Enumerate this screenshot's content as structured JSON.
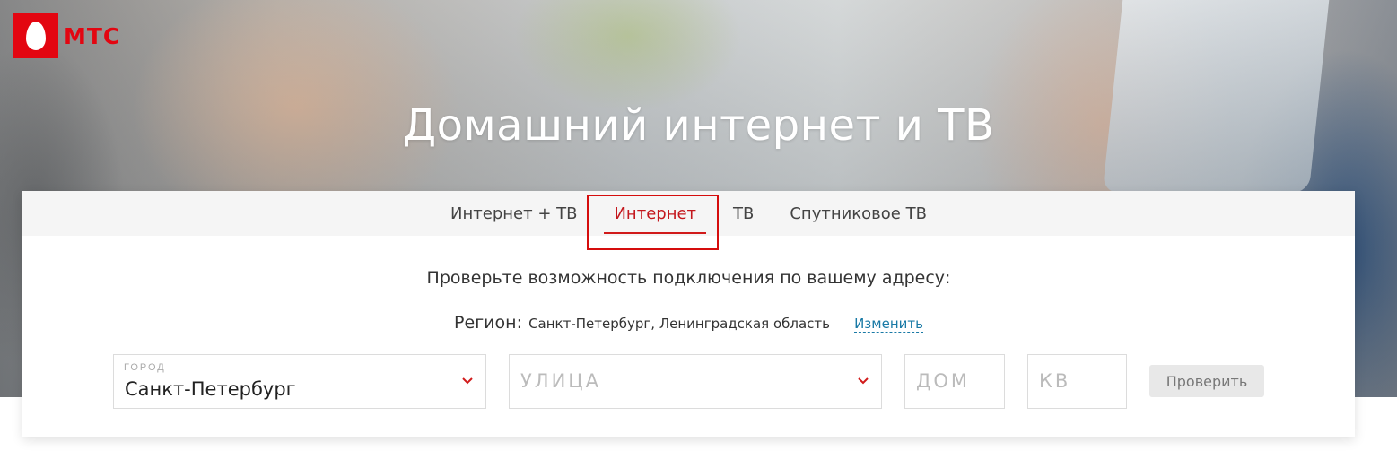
{
  "brand": {
    "name": "МТС",
    "color": "#e30611"
  },
  "hero": {
    "title": "Домашний интернет и ТВ"
  },
  "tabs": [
    {
      "label": "Интернет + ТВ",
      "active": false
    },
    {
      "label": "Интернет",
      "active": true
    },
    {
      "label": "ТВ",
      "active": false
    },
    {
      "label": "Спутниковое ТВ",
      "active": false
    }
  ],
  "form": {
    "title": "Проверьте возможность подключения по вашему адресу:",
    "region_label": "Регион:",
    "region_value": "Санкт-Петербург, Ленинградская область",
    "region_change": "Изменить",
    "city": {
      "label": "ГОРОД",
      "value": "Санкт-Петербург"
    },
    "street": {
      "placeholder": "УЛИЦА"
    },
    "house": {
      "placeholder": "ДОМ"
    },
    "apartment": {
      "placeholder": "КВ"
    },
    "submit_label": "Проверить"
  },
  "colors": {
    "accent": "#d11b1b",
    "link": "#1a7aa6"
  }
}
